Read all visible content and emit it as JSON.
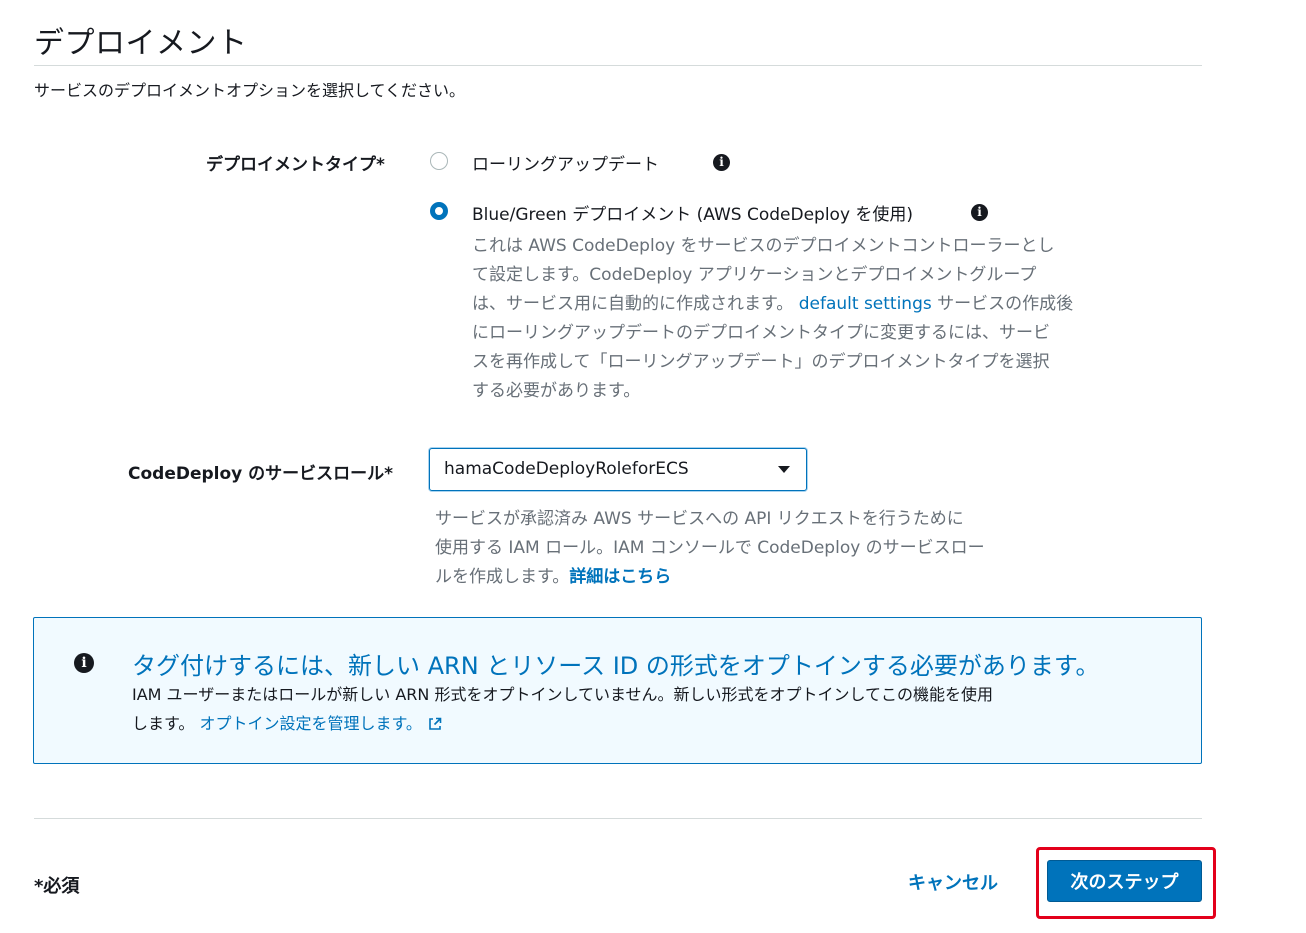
{
  "section": {
    "title": "デプロイメント",
    "description": "サービスのデプロイメントオプションを選択してください。"
  },
  "deployment_type": {
    "label": "デプロイメントタイプ*",
    "options": [
      {
        "label": "ローリングアップデート",
        "selected": false
      },
      {
        "label": "Blue/Green デプロイメント (AWS CodeDeploy を使用)",
        "selected": true
      }
    ],
    "help_lines": [
      "これは AWS CodeDeploy をサービスのデプロイメントコントローラーとし",
      "て設定します。CodeDeploy アプリケーションとデプロイメントグループ",
      "は、サービス用に自動的に作成されます。",
      "default settings",
      "サービスの作成後",
      "にローリングアップデートのデプロイメントタイプに変更するには、サービ",
      "スを再作成して「ローリングアップデート」のデプロイメントタイプを選択",
      "する必要があります。"
    ]
  },
  "service_role": {
    "label": "CodeDeploy のサービスロール*",
    "selected_value": "hamaCodeDeployRoleforECS",
    "help_lines": [
      "サービスが承認済み AWS サービスへの API リクエストを行うために",
      "使用する IAM ロール。IAM コンソールで CodeDeploy のサービスロー",
      "ルを作成します。"
    ],
    "help_link": "詳細はこちら"
  },
  "alert": {
    "icon": "info-icon",
    "title": "タグ付けするには、新しい ARN とリソース ID の形式をオプトインする必要があります。",
    "body_line1": "IAM ユーザーまたはロールが新しい ARN 形式をオプトインしていません。新しい形式をオプトインしてこの機能を使用",
    "body_line2": "します。",
    "link": "オプトイン設定を管理します。"
  },
  "footer": {
    "required_note": "*必須",
    "cancel_label": "キャンセル",
    "next_label": "次のステップ"
  },
  "colors": {
    "accent": "#0073bb",
    "highlight": "#e3001b"
  }
}
